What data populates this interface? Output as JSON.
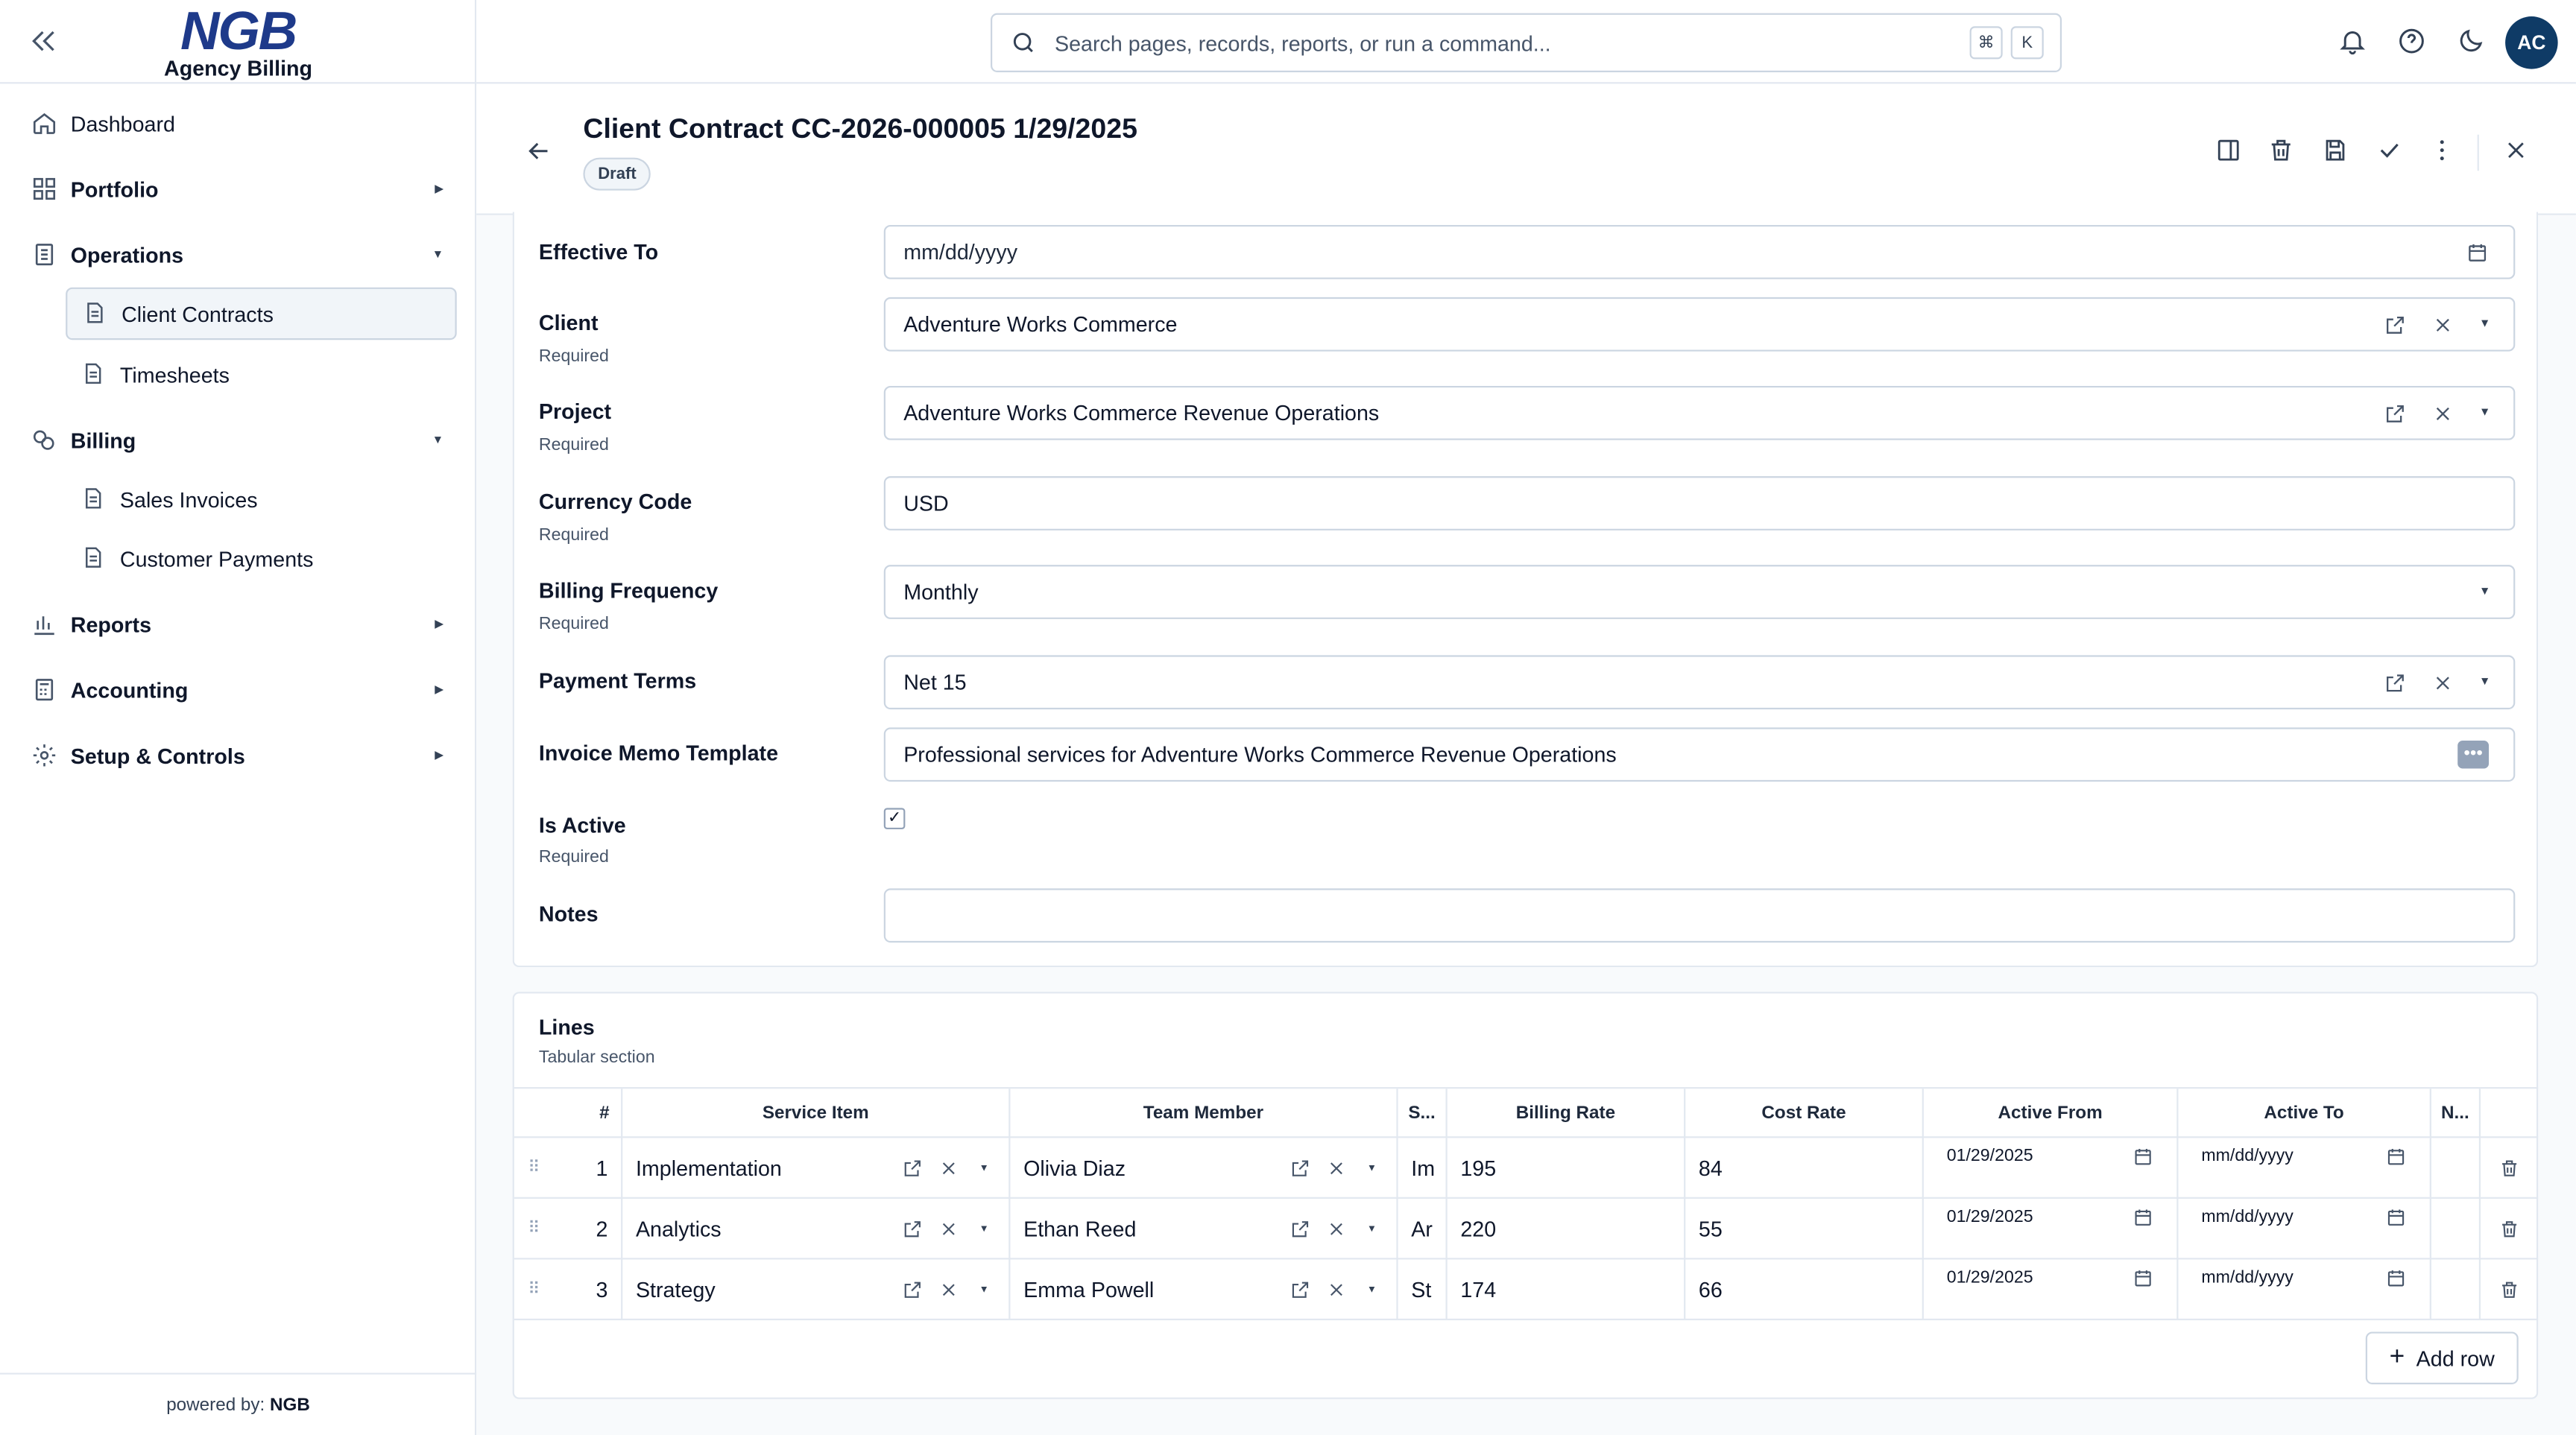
{
  "app": {
    "logo_mark": "NGB",
    "logo_sub": "Agency Billing",
    "footer_prefix": "powered by:",
    "footer_brand": "NGB"
  },
  "sidebar": {
    "items": [
      {
        "label": "Dashboard",
        "icon": "home-icon"
      },
      {
        "label": "Portfolio",
        "icon": "grid-icon"
      },
      {
        "label": "Operations",
        "icon": "clipboard-icon"
      },
      {
        "label": "Client Contracts",
        "icon": "document-icon"
      },
      {
        "label": "Timesheets",
        "icon": "document-icon"
      },
      {
        "label": "Billing",
        "icon": "coins-icon"
      },
      {
        "label": "Sales Invoices",
        "icon": "document-icon"
      },
      {
        "label": "Customer Payments",
        "icon": "document-icon"
      },
      {
        "label": "Reports",
        "icon": "bar-chart-icon"
      },
      {
        "label": "Accounting",
        "icon": "calculator-icon"
      },
      {
        "label": "Setup & Controls",
        "icon": "gear-icon"
      }
    ]
  },
  "topbar": {
    "search_placeholder": "Search pages, records, reports, or run a command...",
    "kbd_cmd": "⌘",
    "kbd_key": "K",
    "avatar_initials": "AC"
  },
  "page": {
    "title": "Client Contract CC-2026-000005 1/29/2025",
    "status": "Draft"
  },
  "form": {
    "required_label": "Required",
    "effective_to": {
      "label": "Effective To",
      "value": "mm/dd/yyyy"
    },
    "client": {
      "label": "Client",
      "value": "Adventure Works Commerce"
    },
    "project": {
      "label": "Project",
      "value": "Adventure Works Commerce Revenue Operations"
    },
    "currency_code": {
      "label": "Currency Code",
      "value": "USD"
    },
    "billing_frequency": {
      "label": "Billing Frequency",
      "value": "Monthly"
    },
    "payment_terms": {
      "label": "Payment Terms",
      "value": "Net 15"
    },
    "invoice_memo": {
      "label": "Invoice Memo Template",
      "value": "Professional services for Adventure Works Commerce Revenue Operations"
    },
    "is_active": {
      "label": "Is Active",
      "checked": true,
      "check_glyph": "✓"
    },
    "notes": {
      "label": "Notes",
      "value": ""
    }
  },
  "lines": {
    "title": "Lines",
    "subtitle": "Tabular section",
    "columns": [
      "#",
      "Service Item",
      "Team Member",
      "S...",
      "Billing Rate",
      "Cost Rate",
      "Active From",
      "Active To",
      "N..."
    ],
    "rows": [
      {
        "num": "1",
        "service_item": "Implementation",
        "team_member": "Olivia Diaz",
        "s": "Im",
        "billing_rate": "195",
        "cost_rate": "84",
        "active_from": "01/29/2025",
        "active_to": "mm/dd/yyyy"
      },
      {
        "num": "2",
        "service_item": "Analytics",
        "team_member": "Ethan Reed",
        "s": "Ar",
        "billing_rate": "220",
        "cost_rate": "55",
        "active_from": "01/29/2025",
        "active_to": "mm/dd/yyyy"
      },
      {
        "num": "3",
        "service_item": "Strategy",
        "team_member": "Emma Powell",
        "s": "St",
        "billing_rate": "174",
        "cost_rate": "66",
        "active_from": "01/29/2025",
        "active_to": "mm/dd/yyyy"
      }
    ],
    "add_row_label": "Add row"
  }
}
